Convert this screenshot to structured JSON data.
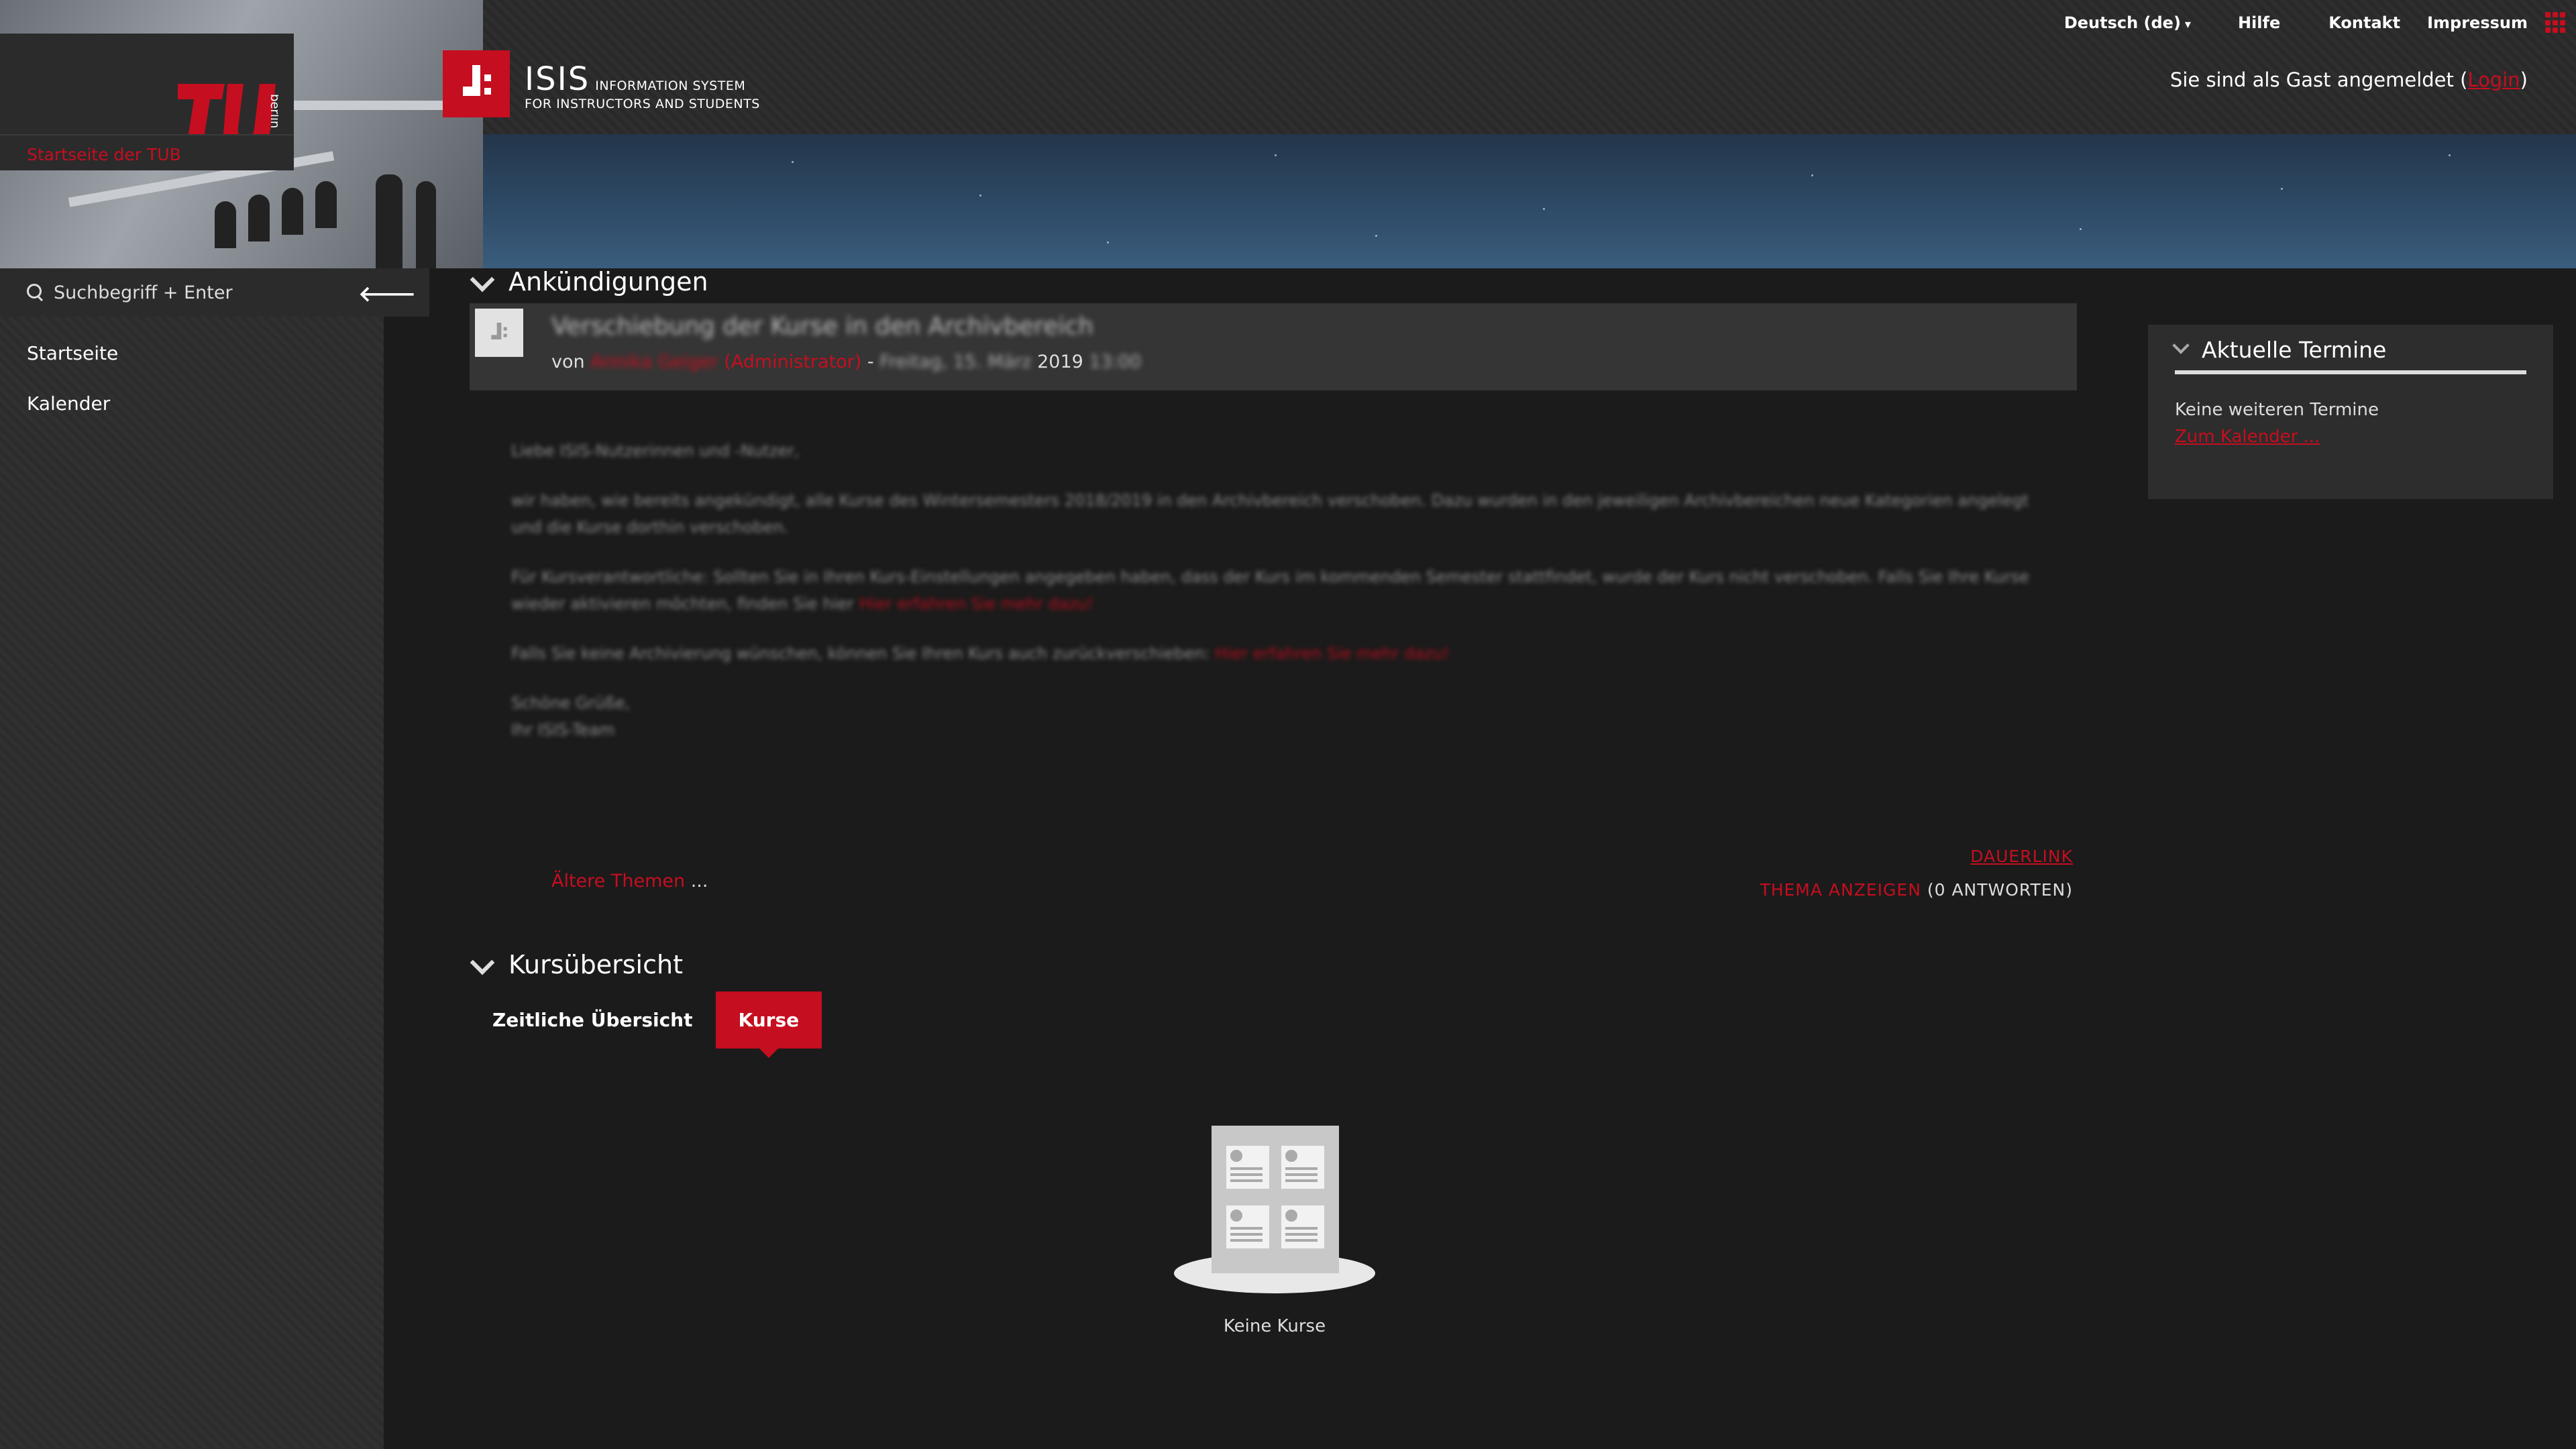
{
  "header": {
    "tub_link": "Startseite der TUB",
    "tu_logo_text": "berlin",
    "isis_title": "ISIS",
    "isis_sub1": "INFORMATION SYSTEM",
    "isis_sub2": "FOR INSTRUCTORS AND STUDENTS",
    "nav": {
      "language": "Deutsch (de)",
      "help": "Hilfe",
      "contact": "Kontakt",
      "imprint": "Impressum"
    },
    "guest_prefix": "Sie sind als Gast angemeldet (",
    "login": "Login",
    "guest_suffix": ")"
  },
  "sidebar": {
    "search_placeholder": "Suchbegriff + Enter",
    "collapse_icon": "arrow-left-icon",
    "items": [
      {
        "label": "Startseite"
      },
      {
        "label": "Kalender"
      }
    ]
  },
  "announcements": {
    "title": "Ankündigungen",
    "post": {
      "subject": "Verschiebung der Kurse in den Archivbereich",
      "by": "von",
      "author": "Annika Geiger",
      "role": "(Administrator)",
      "dash": "-",
      "date_blurred": "Freitag, 15. März",
      "year": "2019",
      "time": "13:00",
      "body": [
        {
          "text": "Liebe ISIS-Nutzerinnen und -Nutzer,"
        },
        {
          "text": "wir haben, wie bereits angekündigt, alle Kurse des Wintersemesters 2018/2019 in den Archivbereich verschoben. Dazu wurden in den jeweiligen Archivbereichen neue Kategorien angelegt und die Kurse dorthin verschoben."
        },
        {
          "text": "Für Kursverantwortliche: Sollten Sie in Ihren Kurs-Einstellungen angegeben haben, dass der Kurs im kommenden Semester stattfindet, wurde der Kurs nicht verschoben. Falls Sie Ihre Kurse wieder aktivieren möchten, finden Sie hier",
          "link": "Hier erfahren Sie mehr dazu!"
        },
        {
          "text": "Falls Sie keine Archivierung wünschen, können Sie Ihren Kurs auch zurückverschieben:",
          "link": "Hier erfahren Sie mehr dazu!"
        },
        {
          "text": "Schöne Grüße, Ihr ISIS-Team"
        }
      ]
    },
    "permalink": "DAUERLINK",
    "older_topics": "Ältere Themen",
    "older_ellipsis": " ...",
    "show_thread": "THEMA ANZEIGEN",
    "replies": " (0 ANTWORTEN)"
  },
  "courses": {
    "title": "Kursübersicht",
    "tabs": [
      {
        "label": "Zeitliche Übersicht",
        "active": false
      },
      {
        "label": "Kurse",
        "active": true
      }
    ],
    "empty": "Keine Kurse"
  },
  "termine": {
    "title": "Aktuelle Termine",
    "none": "Keine weiteren Termine",
    "calendar_link": "Zum Kalender ..."
  },
  "colors": {
    "accent": "#c50e1f",
    "background": "#1b1b1b",
    "sidebar": "#2d2d2d"
  }
}
